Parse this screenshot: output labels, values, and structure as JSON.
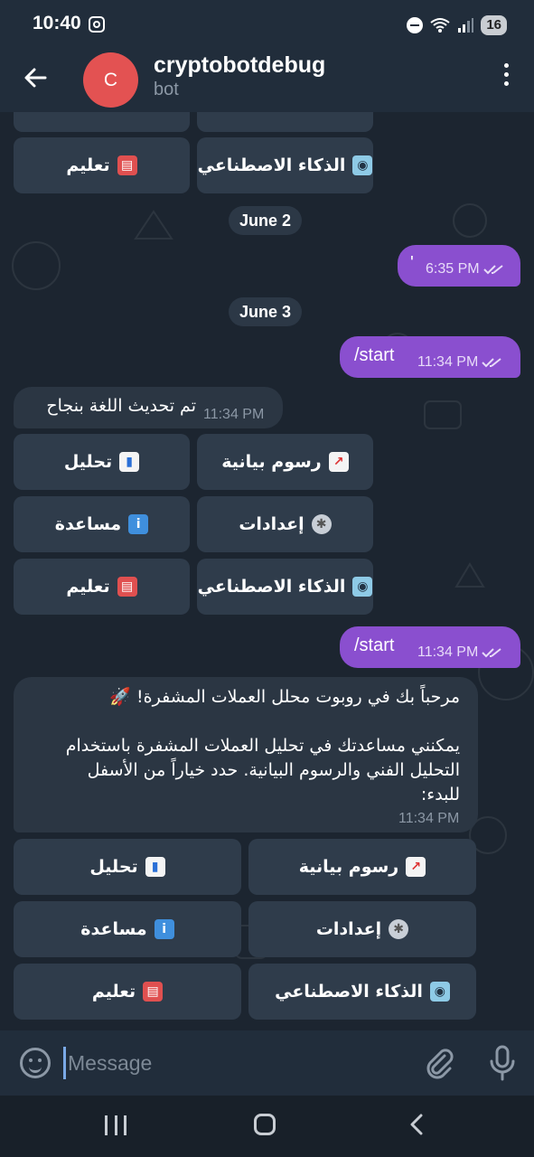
{
  "status_bar": {
    "time": "10:40",
    "battery": "16"
  },
  "header": {
    "avatar_letter": "C",
    "title": "cryptobotdebug",
    "subtitle": "bot"
  },
  "keyboard_labels": {
    "charts": "رسوم بيانية",
    "analysis": "تحليل",
    "settings": "إعدادات",
    "help": "مساعدة",
    "ai": "الذكاء الاصطناعي",
    "education": "تعليم"
  },
  "emoji": {
    "charts": "📈",
    "analysis": "📊",
    "settings": "⚙",
    "help": "i",
    "ai": "🤖",
    "education": "📚"
  },
  "messages": {
    "date_1": "June 2",
    "out_1_text": "'",
    "out_1_time": "6:35 PM",
    "date_2": "June 3",
    "out_2_text": "/start",
    "out_2_time": "11:34 PM",
    "in_1_text": "تم تحديث اللغة بنجاح",
    "in_1_time": "11:34 PM",
    "out_3_text": "/start",
    "out_3_time": "11:34 PM",
    "in_2_line_1": "مرحباً بك في روبوت محلل العملات المشفرة! 🚀",
    "in_2_line_2": "يمكنني مساعدتك في تحليل العملات المشفرة باستخدام",
    "in_2_line_3": "التحليل الفني والرسوم البيانية. حدد خياراً من الأسفل",
    "in_2_line_4": "للبدء:",
    "in_2_time": "11:34 PM"
  },
  "input": {
    "placeholder": "Message"
  },
  "colors": {
    "outgoing_bubble": "#8a4fcf",
    "incoming_bubble": "#2b3643",
    "keyboard_button": "#2f3c4b",
    "header": "#212d3b",
    "avatar": "#e35252"
  }
}
